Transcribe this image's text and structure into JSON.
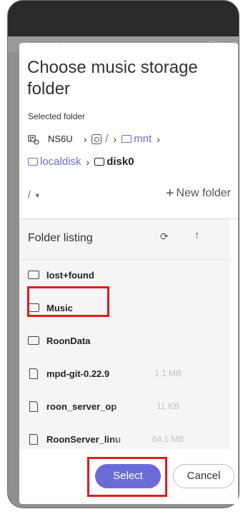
{
  "backdrop": {
    "nav_label": "Logout"
  },
  "dialog": {
    "title": "Choose music storage folder",
    "selected_label": "Selected folder",
    "device_name": "NS6U",
    "root_crumb": "/",
    "crumbs": [
      {
        "label": "mnt",
        "current": false
      },
      {
        "label": "localdisk",
        "current": false
      },
      {
        "label": "disk0",
        "current": true
      }
    ],
    "root_select": "/",
    "new_folder_label": "New folder",
    "listing_header": "Folder listing",
    "items": [
      {
        "name": "lost+found",
        "type": "folder",
        "size": ""
      },
      {
        "name": "Music",
        "type": "folder",
        "size": ""
      },
      {
        "name": "RoonData",
        "type": "folder",
        "size": ""
      },
      {
        "name": "mpd-git-0.22.9",
        "type": "file",
        "size": "1.1 MB"
      },
      {
        "name": "roon_server_op",
        "type": "file",
        "size": "11 KB"
      },
      {
        "name": "RoonServer_linu",
        "type": "file",
        "size": "84.1 MB"
      }
    ],
    "select_label": "Select",
    "cancel_label": "Cancel"
  },
  "colors": {
    "accent": "#6b6bd8",
    "link": "#6a6ad4",
    "highlight": "#e61a1a"
  },
  "icons": [
    "device-icon",
    "root-folder-icon",
    "folder-icon",
    "file-icon",
    "refresh-icon",
    "arrow-up-icon",
    "plus-icon",
    "chevron-right-icon"
  ]
}
